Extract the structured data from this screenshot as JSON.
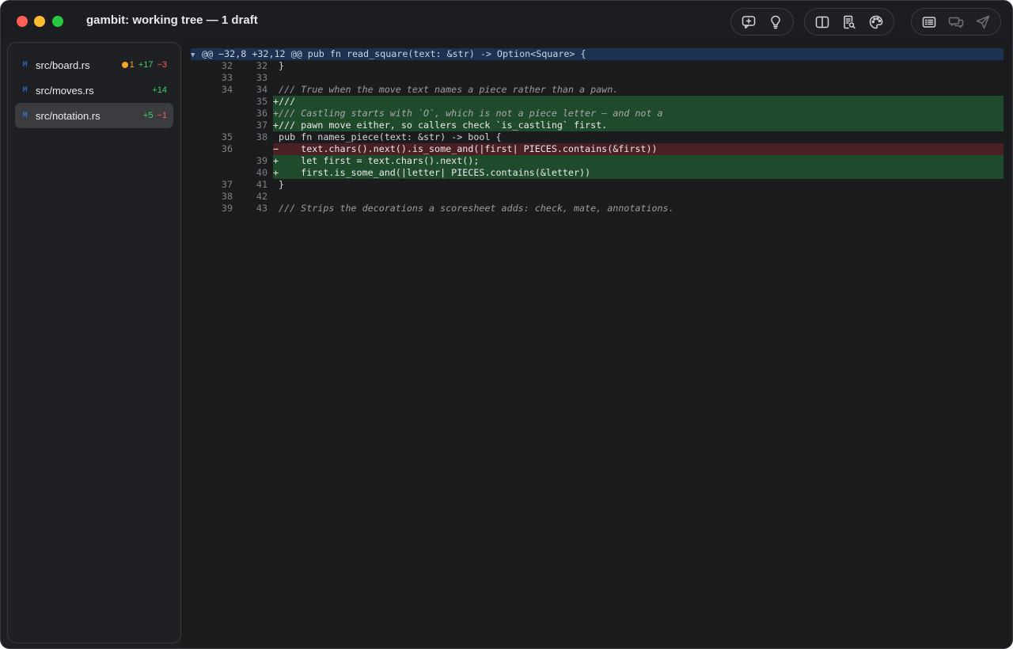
{
  "window": {
    "title": "gambit: working tree — 1 draft"
  },
  "toolbar": {
    "groups": [
      [
        "add-comment-icon",
        "lightbulb-icon"
      ],
      [
        "split-view-icon",
        "document-search-icon",
        "palette-icon"
      ],
      [
        "list-view-icon",
        "chat-bubbles-icon",
        "send-icon"
      ]
    ]
  },
  "sidebar": {
    "files": [
      {
        "badge": "M",
        "name": "src/board.rs",
        "warnings": "1",
        "added": "+17",
        "removed": "−3",
        "selected": false
      },
      {
        "badge": "M",
        "name": "src/moves.rs",
        "warnings": "",
        "added": "+14",
        "removed": "",
        "selected": false
      },
      {
        "badge": "M",
        "name": "src/notation.rs",
        "warnings": "",
        "added": "+5",
        "removed": "−1",
        "selected": true
      }
    ]
  },
  "diff": {
    "hunk_header": "@@ −32,8 +32,12 @@ pub fn read_square(text: &str) -> Option<Square> {",
    "lines": [
      {
        "old": "32",
        "new": "32",
        "type": "context",
        "text": " }"
      },
      {
        "old": "33",
        "new": "33",
        "type": "context",
        "text": ""
      },
      {
        "old": "34",
        "new": "34",
        "type": "context",
        "text": " /// True when the move text names a piece rather than a pawn."
      },
      {
        "old": "",
        "new": "35",
        "type": "added",
        "text": "+///"
      },
      {
        "old": "",
        "new": "36",
        "type": "added",
        "text": "+/// Castling starts with `O`, which is not a piece letter — and not a"
      },
      {
        "old": "",
        "new": "37",
        "type": "added",
        "text": "+/// pawn move either, so callers check `is_castling` first."
      },
      {
        "old": "35",
        "new": "38",
        "type": "context",
        "text": " pub fn names_piece(text: &str) -> bool {"
      },
      {
        "old": "36",
        "new": "",
        "type": "removed",
        "text": "−    text.chars().next().is_some_and(|first| PIECES.contains(&first))"
      },
      {
        "old": "",
        "new": "39",
        "type": "added",
        "text": "+    let first = text.chars().next();"
      },
      {
        "old": "",
        "new": "40",
        "type": "added",
        "text": "+    first.is_some_and(|letter| PIECES.contains(&letter))"
      },
      {
        "old": "37",
        "new": "41",
        "type": "context",
        "text": " }"
      },
      {
        "old": "38",
        "new": "42",
        "type": "context",
        "text": ""
      },
      {
        "old": "39",
        "new": "43",
        "type": "context",
        "text": " /// Strips the decorations a scoresheet adds: check, mate, annotations."
      }
    ]
  }
}
